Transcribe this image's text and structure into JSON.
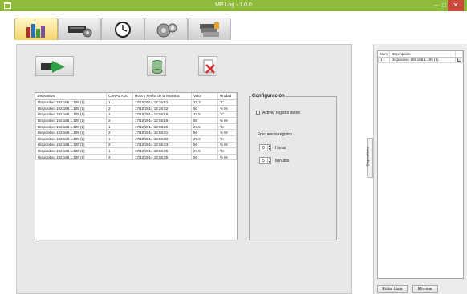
{
  "window": {
    "title": "MP Log - 1.0.0",
    "controls": {
      "minimize": "–",
      "maximize": "□",
      "close": "✕"
    }
  },
  "tabs": [
    {
      "icon": "data-logger-icon",
      "active": true
    },
    {
      "icon": "device-settings-icon",
      "active": false
    },
    {
      "icon": "clock-icon",
      "active": false
    },
    {
      "icon": "gears-icon",
      "active": false
    },
    {
      "icon": "files-icon",
      "active": false
    }
  ],
  "actions": {
    "arrow_icon": "green-arrow-icon",
    "db_icon": "database-icon",
    "delete_icon": "delete-file-icon"
  },
  "grid": {
    "headers": [
      "Dispositivo",
      "CANAL ADC",
      "Hora y Fecha de la Muestra",
      "Valor",
      "Unidad"
    ],
    "rows": [
      [
        "Dispositivo 192.168.1.105 (1)",
        "1",
        "17/10/2014 12:26:42",
        "27.3",
        "°C"
      ],
      [
        "Dispositivo 192.168.1.105 (1)",
        "2",
        "17/10/2014 12:26:42",
        "50",
        "% Hr"
      ],
      [
        "Dispositivo 192.168.1.105 (1)",
        "1",
        "17/10/2014 12:58:19",
        "27.5",
        "°C"
      ],
      [
        "Dispositivo 192.168.1.105 (1)",
        "2",
        "17/10/2014 12:58:19",
        "50",
        "% Hr"
      ],
      [
        "Dispositivo 192.168.1.105 (1)",
        "1",
        "17/10/2014 12:58:20",
        "27.5",
        "°C"
      ],
      [
        "Dispositivo 192.168.1.105 (1)",
        "2",
        "17/10/2014 12:58:21",
        "50",
        "% Hr"
      ],
      [
        "Dispositivo 192.168.1.105 (1)",
        "1",
        "17/10/2014 12:56:23",
        "27.3",
        "°C"
      ],
      [
        "Dispositivo 192.168.1.105 (1)",
        "2",
        "17/10/2014 12:56:23",
        "50",
        "% Hr"
      ],
      [
        "Dispositivo 192.168.1.105 (1)",
        "1",
        "17/10/2014 12:56:25",
        "27.5",
        "°C"
      ],
      [
        "Dispositivo 192.168.1.105 (1)",
        "2",
        "17/10/2014 12:56:25",
        "50",
        "% Hr"
      ]
    ]
  },
  "config": {
    "title": "Configuración",
    "activar_label": "Activar registro datos",
    "frecuencia_label": "Frecuencia registro",
    "horas_value": "0",
    "horas_label": "Horas",
    "minutos_value": "5",
    "minutos_label": "Minutos"
  },
  "side_tab": "Dispositivos",
  "devices": {
    "headers": [
      "Num",
      "Descripción"
    ],
    "rows": [
      {
        "num": "1",
        "desc": "Dispositivo 192.168.1.105 (1)",
        "checked": "✓"
      }
    ]
  },
  "buttons": {
    "edit": "Editar Lista",
    "delete": "Eliminar"
  }
}
